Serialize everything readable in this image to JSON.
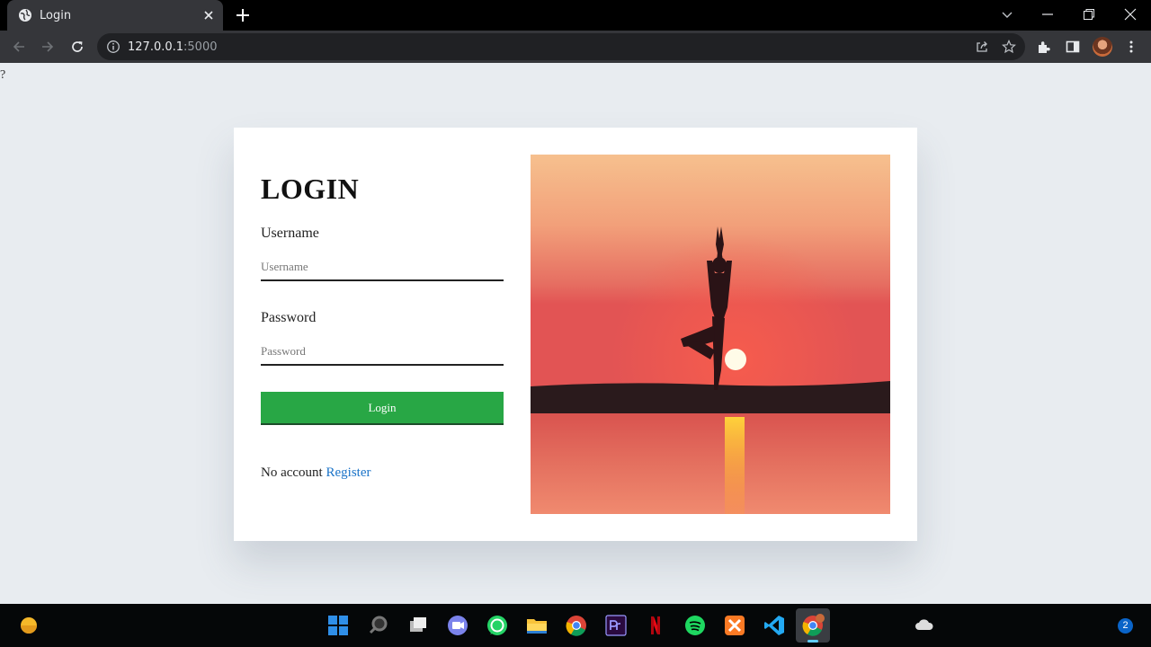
{
  "browser": {
    "tab_title": "Login",
    "url_host": "127.0.0.1",
    "url_port": ":5000"
  },
  "page": {
    "stray_char": "?",
    "title": "LOGIN",
    "username_label": "Username",
    "username_placeholder": "Username",
    "password_label": "Password",
    "password_placeholder": "Password",
    "login_button": "Login",
    "no_account_text": "No account",
    "register_link": "Register"
  },
  "taskbar": {
    "apps": [
      "windows-start",
      "search",
      "task-view",
      "teams-chat",
      "whatsapp",
      "file-explorer",
      "chrome",
      "premiere-pro",
      "netflix",
      "spotify",
      "xampp",
      "vscode",
      "chrome-profile"
    ],
    "notification_count": "2"
  },
  "colors": {
    "login_button": "#28a745",
    "register_link": "#1a73c8",
    "page_background": "#e8ecf0"
  }
}
